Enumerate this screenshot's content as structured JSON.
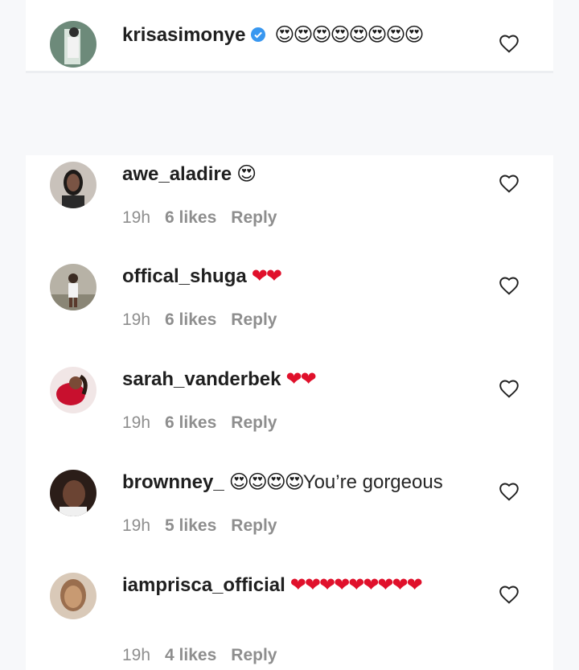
{
  "top_comment": {
    "username": "krisasimonye",
    "verified": true,
    "emojis": "😍😍😍😍😍😍😍😍"
  },
  "comments": [
    {
      "username": "awe_aladire",
      "emojis": "😍",
      "text": "",
      "time": "19h",
      "likes": "6 likes",
      "reply": "Reply"
    },
    {
      "username": "offical_shuga",
      "emojis": "❤❤",
      "text": "",
      "time": "19h",
      "likes": "6 likes",
      "reply": "Reply"
    },
    {
      "username": "sarah_vanderbek",
      "emojis": "❤❤",
      "text": "",
      "time": "19h",
      "likes": "6 likes",
      "reply": "Reply"
    },
    {
      "username": "brownney_",
      "emojis": "😍😍😍😍",
      "text": "You’re gorgeous",
      "time": "19h",
      "likes": "5 likes",
      "reply": "Reply"
    },
    {
      "username": "iamprisca_official",
      "emojis": "❤❤❤❤❤❤❤❤❤",
      "text": "",
      "time": "19h",
      "likes": "4 likes",
      "reply": "Reply"
    }
  ],
  "colors": {
    "background": "#f7f8fa",
    "meta_text": "#8e8e8e",
    "verified_blue": "#3897f0",
    "heart_red": "#e0102b"
  },
  "icons": {
    "like": "heart-outline-icon",
    "verified": "verified-badge-icon"
  }
}
